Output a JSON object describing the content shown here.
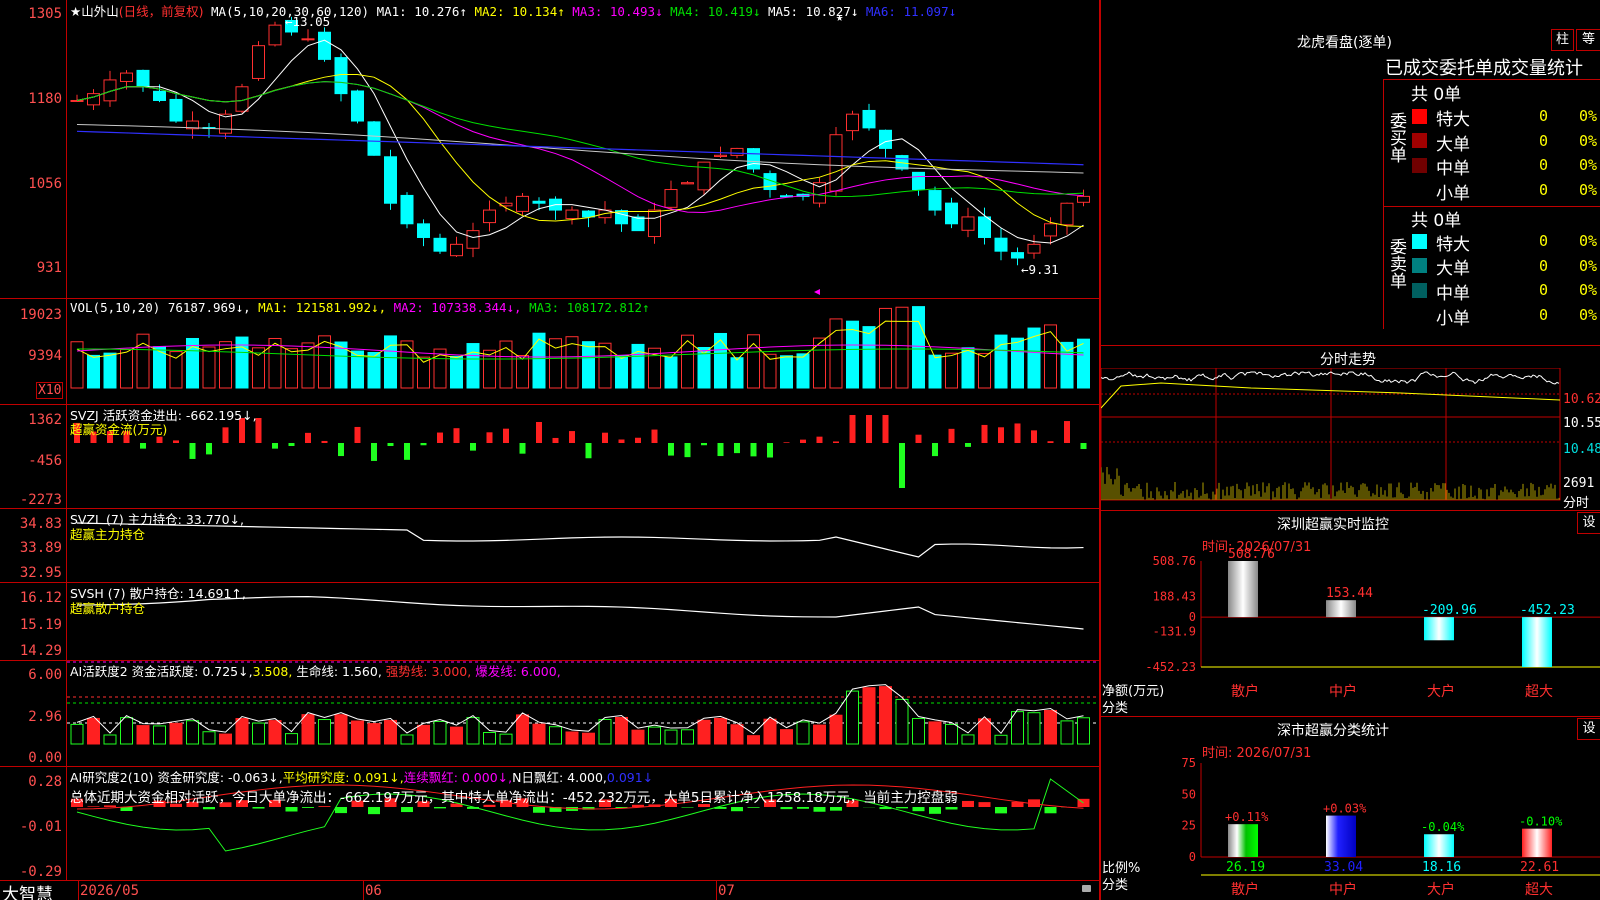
{
  "main": {
    "stock_name": "★山外山",
    "period_tag": "(日线，前复权)",
    "ma_label": "MA(5,10,20,30,60,120)",
    "ma_items": [
      {
        "text": "MA1: 10.276↑",
        "color": "#ffffff"
      },
      {
        "text": "MA2: 10.134↑",
        "color": "#ffff00"
      },
      {
        "text": "MA3: 10.493↓",
        "color": "#ff00ff"
      },
      {
        "text": "MA4: 10.419↓",
        "color": "#00e000"
      },
      {
        "text": "MA5: 10.827↓",
        "color": "#ffffff"
      },
      {
        "text": "MA6: 11.097↓",
        "color": "#3030ff"
      }
    ],
    "y_ticks": [
      "1305",
      "1180",
      "1056",
      "931"
    ],
    "high_mark": "←13.05",
    "low_mark": "←9.31",
    "star": "★"
  },
  "vol": {
    "label": "VOL(5,10,20)",
    "value": "76187.969↓,",
    "ma1": "MA1: 121581.992↓,",
    "ma2": "MA2: 107338.344↓,",
    "ma3": "MA3: 108172.812↑",
    "y_ticks": [
      "19023",
      "9394"
    ],
    "unit": "X10"
  },
  "svzj": {
    "label": "SVZJ  活跃资金进出: -662.195↓,",
    "sub": "超赢资金流(万元)",
    "y_ticks": [
      "1362",
      "-456",
      "-2273"
    ]
  },
  "svzl": {
    "label": "SVZL (7) 主力持仓: 33.770↓,",
    "sub": "超赢主力持仓",
    "y_ticks": [
      "34.83",
      "33.89",
      "32.95"
    ]
  },
  "svsh": {
    "label": "SVSH (7) 散户持仓: 14.691↑,",
    "sub": "超赢散户持仓",
    "y_ticks": [
      "16.12",
      "15.19",
      "14.29"
    ]
  },
  "ai1": {
    "label_white": "AI活跃度2 资金活跃度: 0.725↓,",
    "v2": "3.508,",
    "life": "生命线: 1.560,",
    "strong": "强势线: 3.000,",
    "burst": "爆发线: 6.000,",
    "y_ticks": [
      "6.00",
      "2.96",
      "0.00"
    ]
  },
  "ai2": {
    "label": "AI研究度2(10) 资金研究度: -0.063↓,",
    "avg": "平均研究度: 0.091↓,",
    "cont": "连续飘红: 0.000↓,",
    "n": "N日飘红: 4.000,",
    "last": "0.091↓",
    "summary": "总体近期大资金相对活跃，今日大单净流出：-662.197万元，其中特大单净流出：-452.232万元，大单5日累计净入1258.18万元，当前主力控盘弱",
    "y_ticks": [
      "0.28",
      "-0.01",
      "-0.29"
    ]
  },
  "bottom": {
    "brand": "大智慧",
    "dates": [
      "2026/05",
      "06",
      "07"
    ]
  },
  "dragon": {
    "title": "龙虎看盘(逐单)",
    "btn1": "柱",
    "btn2": "等",
    "subtitle": "已成交委托单成交量统计",
    "buy_label": "委买单",
    "sell_label": "委卖单",
    "buy_total": "共 0单",
    "sell_total": "共 0单",
    "buy_rows": [
      {
        "name": "特大",
        "count": "0",
        "pct": "0%",
        "color": "#ff0000"
      },
      {
        "name": "大单",
        "count": "0",
        "pct": "0%",
        "color": "#a00000"
      },
      {
        "name": "中单",
        "count": "0",
        "pct": "0%",
        "color": "#700000"
      },
      {
        "name": "小单",
        "count": "0",
        "pct": "0%",
        "color": ""
      }
    ],
    "sell_rows": [
      {
        "name": "特大",
        "count": "0",
        "pct": "0%",
        "color": "#00ffff"
      },
      {
        "name": "大单",
        "count": "0",
        "pct": "0%",
        "color": "#008080"
      },
      {
        "name": "中单",
        "count": "0",
        "pct": "0%",
        "color": "#006060"
      },
      {
        "name": "小单",
        "count": "0",
        "pct": "0%",
        "color": ""
      }
    ]
  },
  "intraday": {
    "title": "分时走势",
    "y_ticks": [
      "10.62",
      "10.55",
      "10.48"
    ],
    "vol_tick": "2691",
    "vol_label": "分时"
  },
  "sz_monitor": {
    "title": "深圳超赢实时监控",
    "settings": "设",
    "time": "时间: 2026/07/31",
    "y_ticks": [
      "508.76",
      "188.43",
      "0",
      "-131.9",
      "-452.23"
    ],
    "ylabel": "净额(万元)",
    "xlabel": "分类",
    "categories": [
      "散户",
      "中户",
      "大户",
      "超大"
    ],
    "values": [
      508.76,
      153.44,
      -209.96,
      -452.23
    ],
    "value_labels": [
      "508.76",
      "153.44",
      "-209.96",
      "-452.23"
    ]
  },
  "sz_class": {
    "title": "深市超赢分类统计",
    "settings": "设",
    "time": "时间: 2026/07/31",
    "y_ticks": [
      "75",
      "50",
      "25",
      "0"
    ],
    "ylabel": "比例%",
    "xlabel": "分类",
    "categories": [
      "散户",
      "中户",
      "大户",
      "超大"
    ],
    "values": [
      26.19,
      33.04,
      18.16,
      22.61
    ],
    "changes": [
      "+0.11%",
      "+0.03%",
      "-0.04%",
      "-0.10%"
    ],
    "value_labels": [
      "26.19",
      "33.04",
      "18.16",
      "22.61"
    ]
  },
  "chart_data": [
    {
      "type": "bar",
      "title": "深圳超赢实时监控",
      "categories": [
        "散户",
        "中户",
        "大户",
        "超大"
      ],
      "values": [
        508.76,
        153.44,
        -209.96,
        -452.23
      ],
      "ylabel": "净额(万元)",
      "xlabel": "分类",
      "ylim": [
        -452.23,
        508.76
      ]
    },
    {
      "type": "bar",
      "title": "深市超赢分类统计",
      "categories": [
        "散户",
        "中户",
        "大户",
        "超大"
      ],
      "values": [
        26.19,
        33.04,
        18.16,
        22.61
      ],
      "ylabel": "比例%",
      "xlabel": "分类",
      "ylim": [
        0,
        75
      ]
    }
  ]
}
